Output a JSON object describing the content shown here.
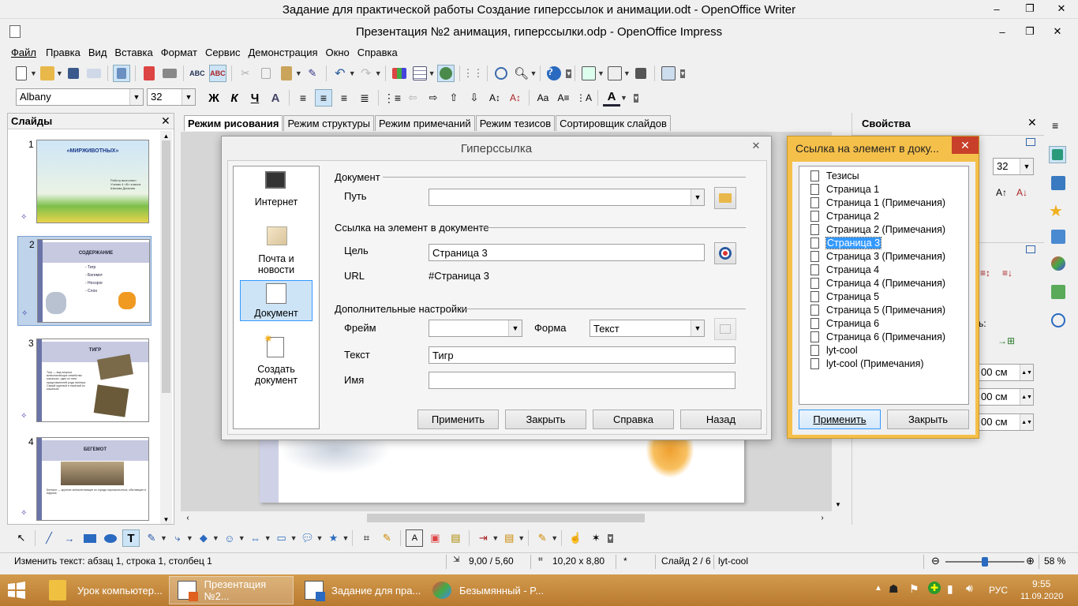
{
  "window_titles": {
    "writer": "Задание для практической работы Создание гиперссылок и анимации.odt - OpenOffice Writer",
    "impress": "Презентация №2 анимация, гиперссылки.odp - OpenOffice Impress"
  },
  "menu": [
    "Файл",
    "Правка",
    "Вид",
    "Вставка",
    "Формат",
    "Сервис",
    "Демонстрация",
    "Окно",
    "Справка"
  ],
  "font": {
    "name": "Albany",
    "size": "32"
  },
  "slides_panel": {
    "title": "Слайды",
    "slides": [
      {
        "num": "1",
        "title": "«МИРЖИВОТНЫХ»",
        "caption": "Работу выполнил Ученик 4 «Б» класса Шахова Дичкова"
      },
      {
        "num": "2",
        "title": "СОДЕРЖАНИЕ",
        "items": [
          "- Тигр",
          "- Бегемот",
          "- Носорог",
          "- Слон"
        ]
      },
      {
        "num": "3",
        "title": "ТИГР",
        "caption": "Тигр — вид хищных млекопитающих семейства кошачьих, один из пяти представителей рода пантера. Самый крупный и тяжёлый из кошачьих."
      },
      {
        "num": "4",
        "title": "БЕГЕМОТ",
        "caption": "Бегемот — крупное млекопитающее из отряда парнокопытных, обитающее в Африке."
      }
    ]
  },
  "view_tabs": [
    "Режим рисования",
    "Режим структуры",
    "Режим примечаний",
    "Режим тезисов",
    "Сортировщик слайдов"
  ],
  "properties_panel": {
    "title": "Свойства",
    "font_size": "32",
    "units": [
      "00 см",
      "00 см",
      "00 см"
    ],
    "char_label": "ь:"
  },
  "hyperlink_dialog": {
    "title": "Гиперссылка",
    "nav": [
      {
        "label": "Интернет"
      },
      {
        "label": "Почта и новости"
      },
      {
        "label": "Документ"
      },
      {
        "label": "Создать документ"
      }
    ],
    "section_document": "Документ",
    "path_label": "Путь",
    "path_value": "",
    "section_target": "Ссылка на элемент в документе",
    "target_label": "Цель",
    "target_value": "Страница 3",
    "url_label": "URL",
    "url_value": "#Страница 3",
    "section_extra": "Дополнительные настройки",
    "frame_label": "Фрейм",
    "frame_value": "",
    "form_label": "Форма",
    "form_value": "Текст",
    "text_label": "Текст",
    "text_value": "Тигр",
    "name_label": "Имя",
    "name_value": "",
    "buttons": {
      "apply": "Применить",
      "close": "Закрыть",
      "help": "Справка",
      "back": "Назад"
    }
  },
  "target_dialog": {
    "title": "Ссылка на элемент в доку...",
    "items": [
      "Тезисы",
      "Страница 1",
      "Страница 1 (Примечания)",
      "Страница 2",
      "Страница 2 (Примечания)",
      "Страница 3",
      "Страница 3 (Примечания)",
      "Страница 4",
      "Страница 4 (Примечания)",
      "Страница 5",
      "Страница 5 (Примечания)",
      "Страница 6",
      "Страница 6 (Примечания)",
      "lyt-cool",
      "lyt-cool (Примечания)"
    ],
    "selected": "Страница 3",
    "buttons": {
      "apply": "Применить",
      "close": "Закрыть"
    }
  },
  "statusbar": {
    "edit_status": "Изменить текст: абзац 1, строка 1, столбец 1",
    "position": "9,00 / 5,60",
    "size": "10,20 x 8,80",
    "modified": "*",
    "slide": "Слайд 2 / 6",
    "layout": "lyt-cool",
    "zoom": "58 %",
    "zoom_level": 0.5
  },
  "taskbar": {
    "items": [
      "Урок компьютер...",
      "Презентация №2...",
      "Задание для пра...",
      "Безымянный - P..."
    ],
    "lang": "РУС",
    "time": "9:55",
    "date": "11.09.2020"
  },
  "colors": {
    "selection": "#3399ff",
    "dialog_accent": "#f5c04a",
    "taskbar": "#c98a3c"
  }
}
